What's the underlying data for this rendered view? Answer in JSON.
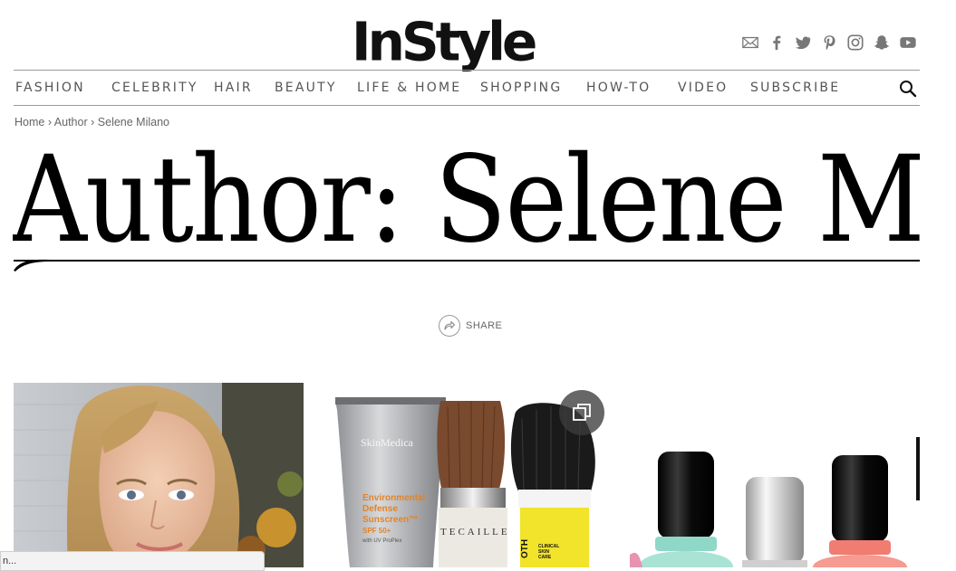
{
  "header": {
    "logo_text": "InStyle",
    "social_icons": [
      "email-icon",
      "facebook-icon",
      "twitter-icon",
      "pinterest-icon",
      "instagram-icon",
      "snapchat-icon",
      "youtube-icon"
    ]
  },
  "nav": {
    "items": [
      {
        "label": "FASHION"
      },
      {
        "label": "CELEBRITY"
      },
      {
        "label": "HAIR"
      },
      {
        "label": "BEAUTY"
      },
      {
        "label": "LIFE & HOME"
      },
      {
        "label": "SHOPPING"
      },
      {
        "label": "HOW-TO"
      },
      {
        "label": "VIDEO"
      },
      {
        "label": "SUBSCRIBE"
      }
    ],
    "search_icon": "search-icon"
  },
  "breadcrumb": {
    "home": "Home",
    "sep": "›",
    "author": "Author",
    "current": "Selene Milano"
  },
  "page": {
    "title": "Author: Selene Milano",
    "share_label": "SHARE"
  },
  "cards": {
    "card2_brand": "SkinMedica",
    "card2_product": "Environmental Defense Sunscreen",
    "card2_spf": "SPF 50+",
    "card2_tech": "with UV ProPlex",
    "card2_brush_brand": "TECAILLE",
    "card2_tube_text": "CLINICAL SKIN CARE"
  },
  "status": {
    "text": "n..."
  },
  "colors": {
    "text": "#111111",
    "nav_text": "#555555",
    "rule": "#9a9a9a",
    "sunscreen_orange": "#e0842a",
    "yellow_tube": "#f2e32b",
    "polish_mint": "#8fd8c8",
    "polish_coral": "#f07c72"
  }
}
